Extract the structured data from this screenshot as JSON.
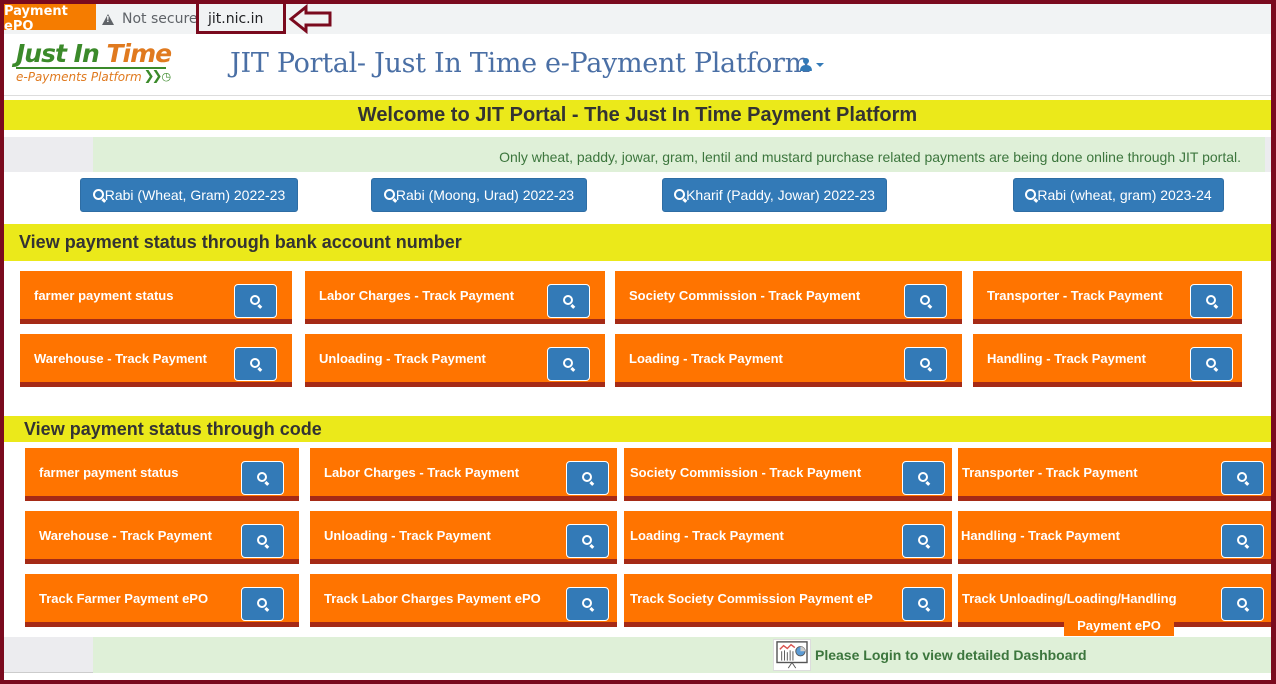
{
  "browser": {
    "tab_fragment": "Payment ePO",
    "security_label": "Not secure",
    "url": "jit.nic.in"
  },
  "header": {
    "logo_word1": "Just ",
    "logo_word2": "In ",
    "logo_word3": "Time",
    "logo_sub": "e-Payments Platform",
    "title": "JIT Portal- Just In Time e-Payment Platform"
  },
  "welcome": "Welcome to JIT Portal - The Just In Time Payment Platform",
  "notice": "Only wheat, paddy, jowar, gram, lentil and mustard purchase related payments are being done online through JIT portal.",
  "seasons": [
    {
      "label": "Rabi (Wheat, Gram) 2022-23"
    },
    {
      "label": "Rabi (Moong, Urad) 2022-23"
    },
    {
      "label": "Kharif (Paddy, Jowar) 2022-23"
    },
    {
      "label": "Rabi (wheat, gram) 2023-24"
    }
  ],
  "bank_section": {
    "title": "View payment status through bank account number",
    "tiles": [
      {
        "label": "farmer payment status"
      },
      {
        "label": "Labor Charges - Track Payment"
      },
      {
        "label": "Society Commission - Track Payment"
      },
      {
        "label": "Transporter - Track Payment"
      },
      {
        "label": "Warehouse - Track Payment"
      },
      {
        "label": "Unloading - Track Payment"
      },
      {
        "label": "Loading - Track Payment"
      },
      {
        "label": "Handling - Track Payment"
      }
    ]
  },
  "code_section": {
    "title": "View payment status through code",
    "tiles": [
      {
        "label": "farmer payment status"
      },
      {
        "label": "Labor Charges - Track Payment"
      },
      {
        "label": "Society Commission - Track Payment"
      },
      {
        "label": "Transporter - Track Payment"
      },
      {
        "label": "Warehouse - Track Payment"
      },
      {
        "label": "Unloading - Track Payment"
      },
      {
        "label": "Loading - Track Payment"
      },
      {
        "label": "Handling - Track Payment"
      },
      {
        "label": "Track Farmer Payment ePO"
      },
      {
        "label": "Track Labor Charges Payment ePO"
      },
      {
        "label": "Track Society Commission Payment eP"
      },
      {
        "label": "Track Unloading/Loading/Handling"
      }
    ],
    "overflow_label": "Payment ePO"
  },
  "footer": {
    "dashboard_text": "Please Login to view detailed Dashboard"
  },
  "colors": {
    "tile_orange": "#ff7400",
    "tile_border": "#a52a16",
    "button_blue": "#337ab7",
    "highlight_yellow": "#ebe91a",
    "frame_maroon": "#7a0a1e"
  }
}
